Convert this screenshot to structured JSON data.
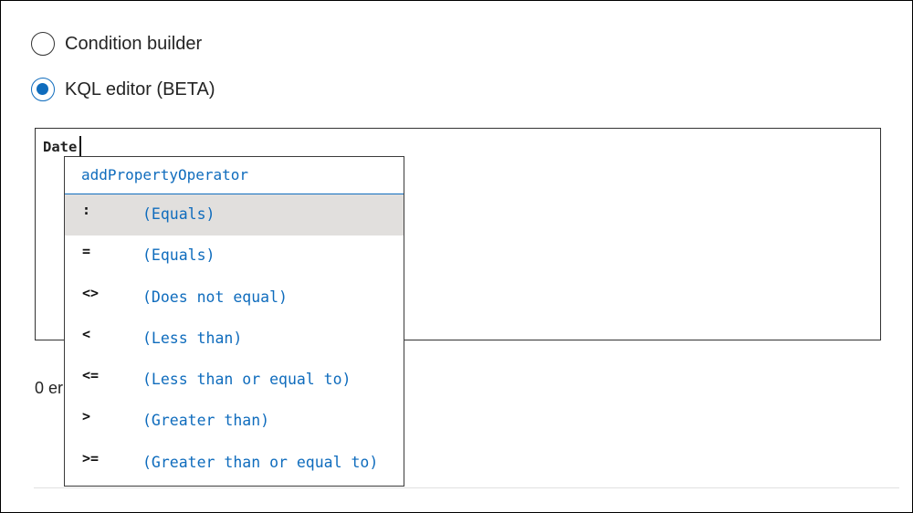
{
  "query_mode": {
    "options": [
      {
        "label": "Condition builder",
        "checked": false
      },
      {
        "label": "KQL editor (BETA)",
        "checked": true
      }
    ]
  },
  "editor": {
    "text": "Date"
  },
  "status": {
    "error_text_visible": "0 er"
  },
  "autocomplete": {
    "header": "addPropertyOperator",
    "selected_index": 0,
    "items": [
      {
        "op": ":",
        "desc": "(Equals)"
      },
      {
        "op": "=",
        "desc": "(Equals)"
      },
      {
        "op": "<>",
        "desc": "(Does not equal)"
      },
      {
        "op": "<",
        "desc": "(Less than)"
      },
      {
        "op": "<=",
        "desc": "(Less than or equal to)"
      },
      {
        "op": ">",
        "desc": "(Greater than)"
      },
      {
        "op": ">=",
        "desc": "(Greater than or equal to)"
      }
    ]
  },
  "colors": {
    "accent": "#0f6cbd",
    "selected_row": "#e1dfdd"
  }
}
